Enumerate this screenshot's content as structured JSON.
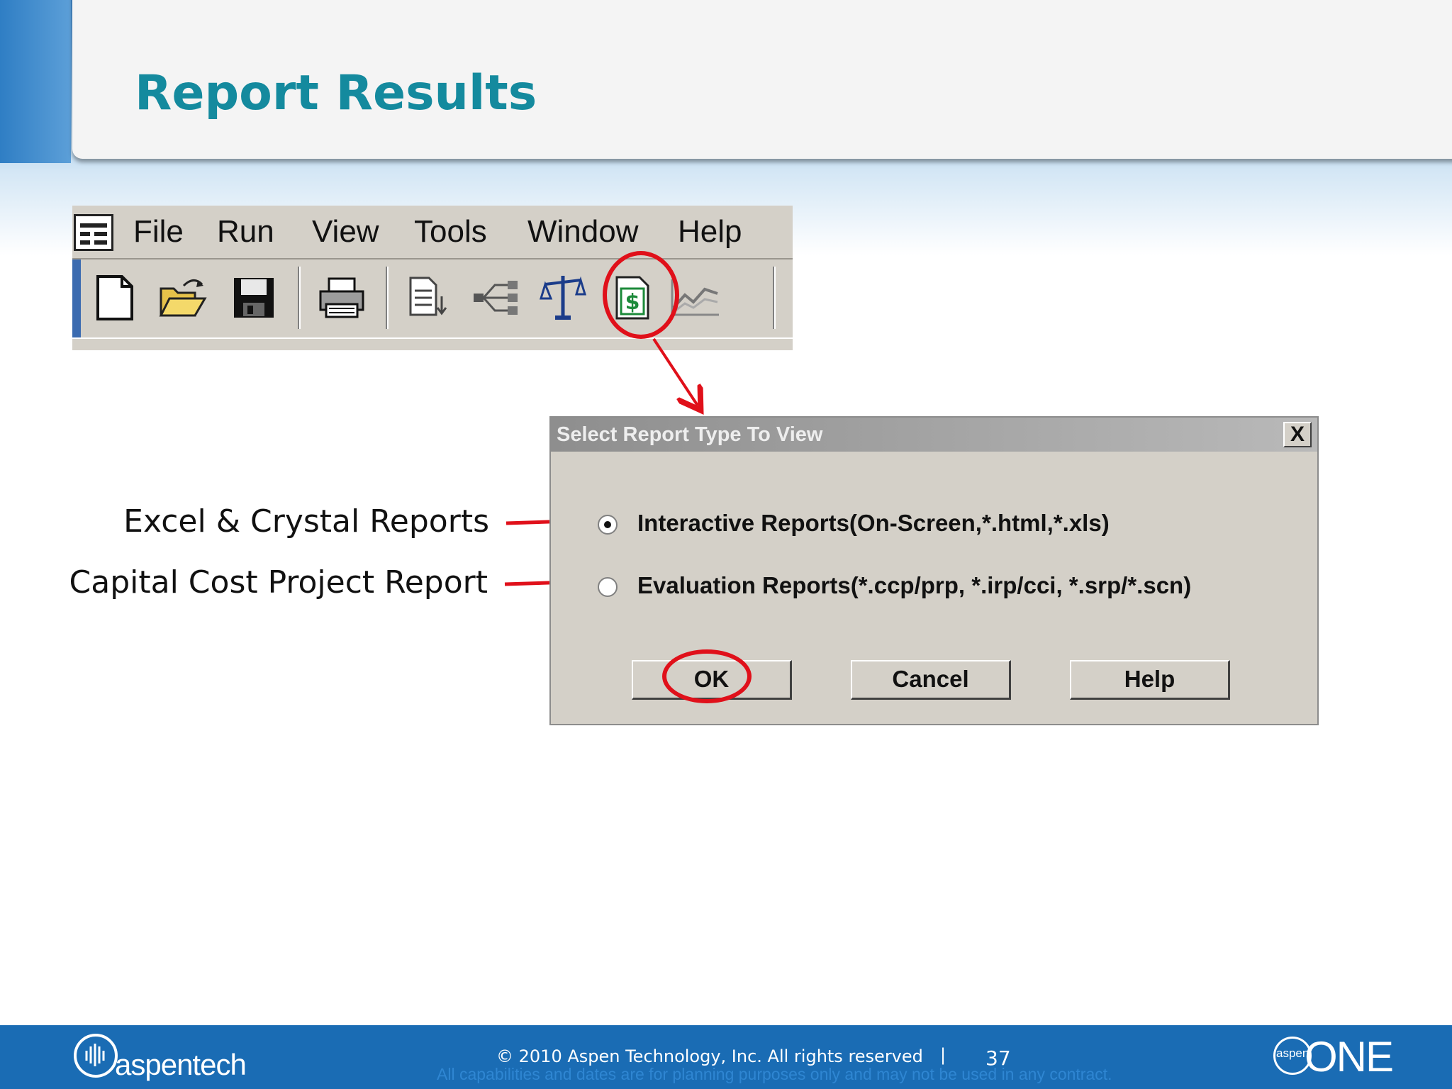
{
  "slide": {
    "title": "Report Results"
  },
  "menubar": {
    "items": [
      "File",
      "Run",
      "View",
      "Tools",
      "Window",
      "Help"
    ]
  },
  "toolbar": {
    "icons": [
      "new-document-icon",
      "open-folder-icon",
      "save-icon",
      "print-icon",
      "report-list-icon",
      "flowsheet-icon",
      "balance-icon",
      "cost-report-icon",
      "chart-icon"
    ]
  },
  "dialog": {
    "title": "Select Report Type To View",
    "close_label": "X",
    "options": [
      {
        "label": "Interactive Reports(On-Screen,*.html,*.xls)",
        "selected": true
      },
      {
        "label": "Evaluation Reports(*.ccp/prp, *.irp/cci, *.srp/*.scn)",
        "selected": false
      }
    ],
    "buttons": {
      "ok": "OK",
      "cancel": "Cancel",
      "help": "Help"
    }
  },
  "annotations": {
    "excel_crystal": "Excel & Crystal Reports",
    "capital_cost": "Capital Cost Project Report",
    "highlight_color": "#e0101a"
  },
  "footer": {
    "brand": "aspentech",
    "copyright": "© 2010 Aspen Technology, Inc. All rights reserved",
    "separator": "|",
    "page_number": "37",
    "disclaimer": "All capabilities and dates are for planning purposes only and may not be used in any contract.",
    "product_small": "aspen",
    "product_big": "ONE"
  }
}
